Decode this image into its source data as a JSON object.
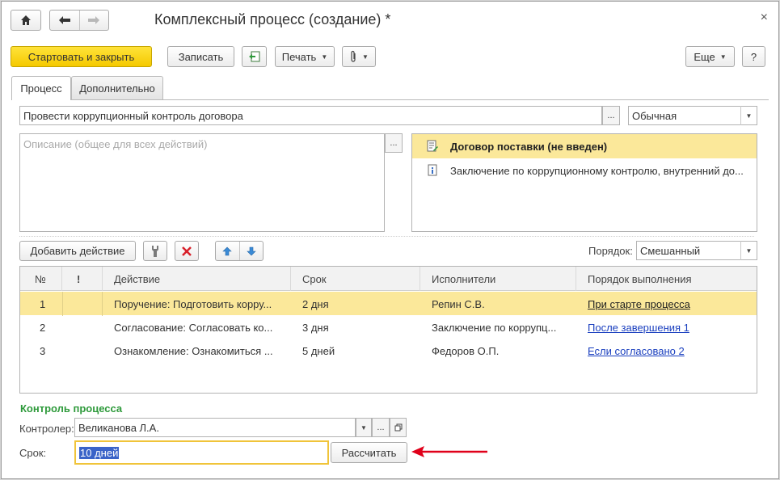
{
  "window": {
    "title": "Комплексный процесс (создание) *",
    "close": "×"
  },
  "toolbar": {
    "start_close": "Стартовать и закрыть",
    "save": "Записать",
    "print": "Печать",
    "more": "Еще",
    "help": "?"
  },
  "tabs": [
    {
      "label": "Процесс",
      "active": true
    },
    {
      "label": "Дополнительно",
      "active": false
    }
  ],
  "process": {
    "name": "Провести коррупционный контроль договора",
    "name_btn": "...",
    "importance": "Обычная",
    "description_placeholder": "Описание (общее для всех действий)",
    "description_btn": "..."
  },
  "attachments": [
    {
      "text": "Договор поставки (не введен)",
      "bold": true,
      "selected": true,
      "icon": "edit-doc-icon"
    },
    {
      "text": "Заключение по коррупционному контролю, внутренний до...",
      "bold": false,
      "selected": false,
      "icon": "doc-icon"
    }
  ],
  "actions_toolbar": {
    "add_action": "Добавить действие",
    "order_label": "Порядок:",
    "order_value": "Смешанный"
  },
  "table": {
    "headers": [
      "№",
      "!",
      "Действие",
      "Срок",
      "Исполнители",
      "Порядок выполнения"
    ],
    "rows": [
      {
        "num": "1",
        "action": "Поручение: Подготовить корру...",
        "term": "2 дня",
        "executor": "Репин С.В.",
        "order": "При старте процесса",
        "selected": true
      },
      {
        "num": "2",
        "action": "Согласование: Согласовать ко...",
        "term": "3 дня",
        "executor": "Заключение по коррупц...",
        "order": "После завершения 1",
        "selected": false
      },
      {
        "num": "3",
        "action": "Ознакомление: Ознакомиться ...",
        "term": "5 дней",
        "executor": "Федоров О.П.",
        "order": "Если согласовано 2",
        "selected": false
      }
    ]
  },
  "control": {
    "section_title": "Контроль процесса",
    "controller_label": "Контролер:",
    "controller_value": "Великанова Л.А.",
    "controller_btn": "...",
    "term_label": "Срок:",
    "term_value": "10 дней",
    "calc_button": "Рассчитать"
  },
  "colors": {
    "accent_yellow": "#f5c900",
    "selection": "#fbe89a",
    "section_green": "#2e9a3b",
    "link_blue": "#1a3fbf",
    "arrow_red": "#e0001a"
  }
}
